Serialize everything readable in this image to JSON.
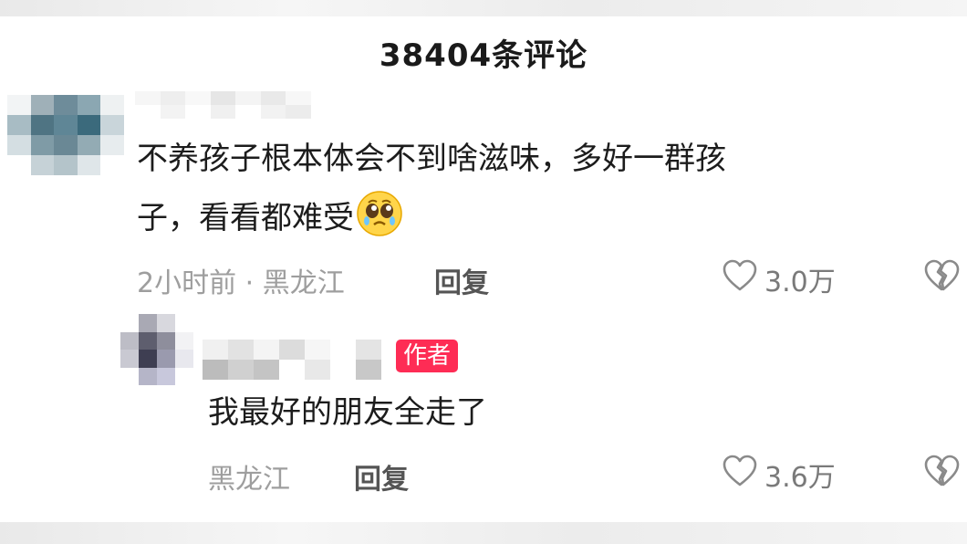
{
  "header": {
    "title": "38404条评论"
  },
  "comments": [
    {
      "text_line1": "不养孩子根本体会不到啥滋味，多好一群孩",
      "text_line2": "子，看看都难受",
      "emoji": "pleading-face-icon",
      "meta": "2小时前 · 黑龙江",
      "reply_label": "回复",
      "likes": "3.0万"
    }
  ],
  "reply": {
    "badge": "作者",
    "text": "我最好的朋友全走了",
    "meta": "黑龙江",
    "reply_label": "回复",
    "likes": "3.6万"
  },
  "colors": {
    "badge": "#fe2c55",
    "meta": "#9e9e9e"
  }
}
